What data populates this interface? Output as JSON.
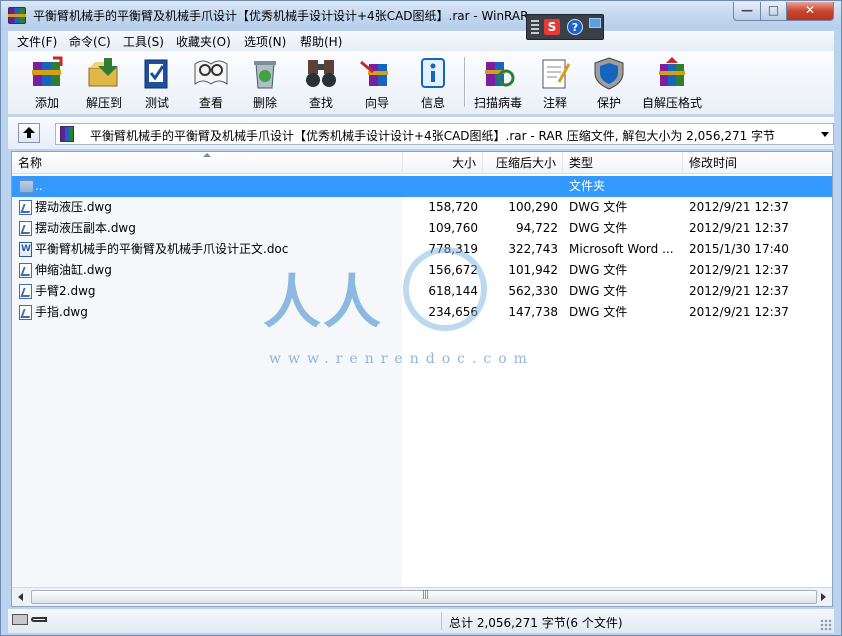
{
  "window": {
    "title": "平衡臂机械手的平衡臂及机械手爪设计【优秀机械手设计设计+4张CAD图纸】.rar - WinRAR",
    "minimize_glyph": "—",
    "maximize_glyph": "□",
    "close_glyph": "✕"
  },
  "floating_toolbar": {
    "s_label": "S",
    "help_label": "?"
  },
  "menu": [
    {
      "label": "文件(F)"
    },
    {
      "label": "命令(C)"
    },
    {
      "label": "工具(S)"
    },
    {
      "label": "收藏夹(O)"
    },
    {
      "label": "选项(N)"
    },
    {
      "label": "帮助(H)"
    }
  ],
  "toolbar": [
    {
      "label": "添加",
      "icon": "add-archive-icon"
    },
    {
      "label": "解压到",
      "icon": "extract-to-icon"
    },
    {
      "label": "测试",
      "icon": "test-icon"
    },
    {
      "label": "查看",
      "icon": "view-icon"
    },
    {
      "label": "删除",
      "icon": "delete-icon"
    },
    {
      "label": "查找",
      "icon": "find-icon"
    },
    {
      "label": "向导",
      "icon": "wizard-icon"
    },
    {
      "label": "信息",
      "icon": "info-icon"
    },
    {
      "label": "扫描病毒",
      "icon": "virus-scan-icon"
    },
    {
      "label": "注释",
      "icon": "comment-icon"
    },
    {
      "label": "保护",
      "icon": "protect-icon"
    },
    {
      "label": "自解压格式",
      "icon": "sfx-icon"
    }
  ],
  "address": {
    "text": "平衡臂机械手的平衡臂及机械手爪设计【优秀机械手设计设计+4张CAD图纸】.rar - RAR 压缩文件, 解包大小为 2,056,271 字节"
  },
  "columns": {
    "name": "名称",
    "size": "大小",
    "packed": "压缩后大小",
    "type": "类型",
    "modified": "修改时间"
  },
  "files": [
    {
      "name": "..",
      "size": "",
      "packed": "",
      "type": "文件夹",
      "modified": "",
      "icon": "folder-up-icon",
      "selected": true
    },
    {
      "name": "摆动液压.dwg",
      "size": "158,720",
      "packed": "100,290",
      "type": "DWG 文件",
      "modified": "2012/9/21 12:37",
      "icon": "dwg-file-icon"
    },
    {
      "name": "摆动液压副本.dwg",
      "size": "109,760",
      "packed": "94,722",
      "type": "DWG 文件",
      "modified": "2012/9/21 12:37",
      "icon": "dwg-file-icon"
    },
    {
      "name": "平衡臂机械手的平衡臂及机械手爪设计正文.doc",
      "size": "778,319",
      "packed": "322,743",
      "type": "Microsoft Word ...",
      "modified": "2015/1/30 17:40",
      "icon": "word-doc-icon"
    },
    {
      "name": "伸缩油缸.dwg",
      "size": "156,672",
      "packed": "101,942",
      "type": "DWG 文件",
      "modified": "2012/9/21 12:37",
      "icon": "dwg-file-icon"
    },
    {
      "name": "手臂2.dwg",
      "size": "618,144",
      "packed": "562,330",
      "type": "DWG 文件",
      "modified": "2012/9/21 12:37",
      "icon": "dwg-file-icon"
    },
    {
      "name": "手指.dwg",
      "size": "234,656",
      "packed": "147,738",
      "type": "DWG 文件",
      "modified": "2012/9/21 12:37",
      "icon": "dwg-file-icon"
    }
  ],
  "watermark": {
    "text": "人人",
    "url": "www.renrendoc.com"
  },
  "status": {
    "text": "总计 2,056,271 字节(6 个文件)"
  }
}
